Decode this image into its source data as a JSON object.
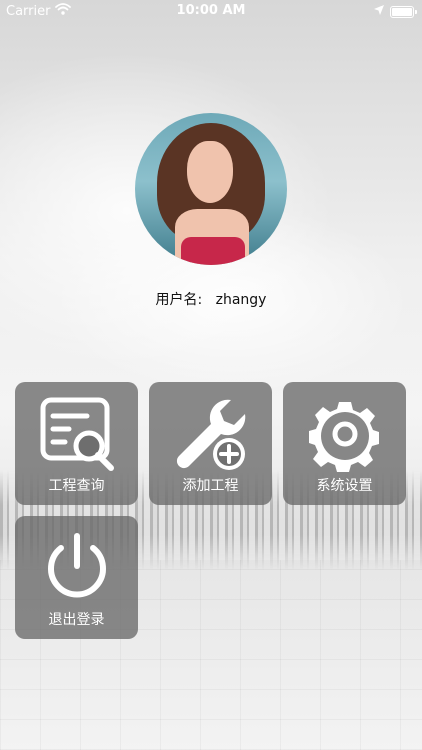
{
  "status_bar": {
    "carrier": "Carrier",
    "time": "10:00 AM",
    "icons": [
      "wifi-icon",
      "location-arrow-icon",
      "battery-icon"
    ]
  },
  "profile": {
    "username_label": "用户名:",
    "username_value": "zhangy",
    "avatar": "avatar-photo"
  },
  "menu": {
    "items": [
      {
        "label": "工程查询",
        "icon": "document-search-icon"
      },
      {
        "label": "添加工程",
        "icon": "wrench-add-icon"
      },
      {
        "label": "系统设置",
        "icon": "gear-icon"
      },
      {
        "label": "退出登录",
        "icon": "power-icon"
      }
    ]
  },
  "colors": {
    "tile_background": "#696969",
    "tile_text": "#ffffff",
    "status_text": "#ffffff"
  }
}
